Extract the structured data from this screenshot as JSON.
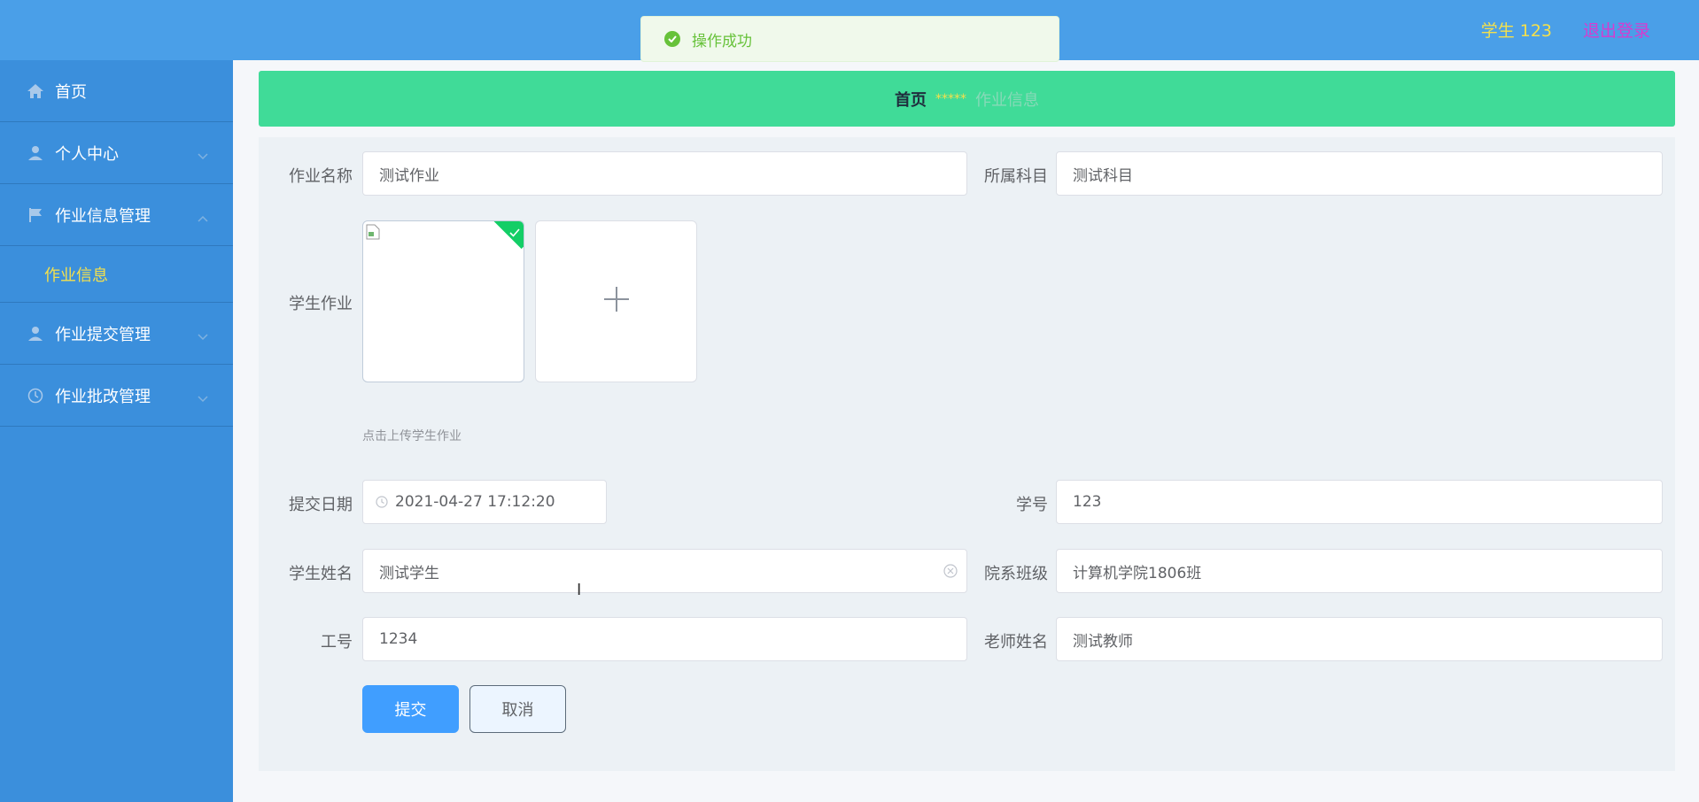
{
  "header": {
    "user": "学生 123",
    "logout": "退出登录"
  },
  "toast": {
    "message": "操作成功"
  },
  "sidebar": {
    "items": [
      {
        "label": "首页"
      },
      {
        "label": "个人中心"
      },
      {
        "label": "作业信息管理",
        "sub": "作业信息"
      },
      {
        "label": "作业提交管理"
      },
      {
        "label": "作业批改管理"
      }
    ]
  },
  "breadcrumb": {
    "home": "首页",
    "separator": "*****",
    "current": "作业信息"
  },
  "form": {
    "name_label": "作业名称",
    "name_value": "测试作业",
    "subject_label": "所属科目",
    "subject_value": "测试科目",
    "homework_label": "学生作业",
    "upload_tip": "点击上传学生作业",
    "date_label": "提交日期",
    "date_value": "2021-04-27 17:12:20",
    "student_no_label": "学号",
    "student_no_value": "123",
    "student_name_label": "学生姓名",
    "student_name_value": "测试学生",
    "class_label": "院系班级",
    "class_value": "计算机学院1806班",
    "staff_no_label": "工号",
    "staff_no_value": "1234",
    "teacher_label": "老师姓名",
    "teacher_value": "测试教师",
    "submit": "提交",
    "cancel": "取消"
  }
}
